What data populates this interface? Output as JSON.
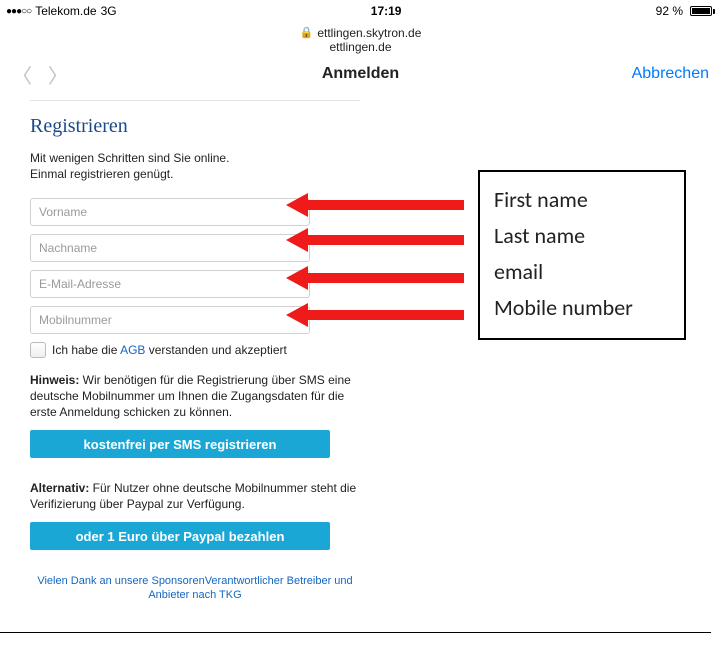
{
  "status": {
    "carrier": "Telekom.de",
    "network": "3G",
    "time": "17:19",
    "battery_pct": "92 %"
  },
  "browser": {
    "domain_full": "ettlingen.skytron.de",
    "domain_short": "ettlingen.de"
  },
  "toolbar": {
    "title": "Anmelden",
    "cancel": "Abbrechen"
  },
  "reg": {
    "heading": "Registrieren",
    "intro1": "Mit wenigen Schritten sind Sie online.",
    "intro2": "Einmal registrieren genügt.",
    "fields": {
      "first": "Vorname",
      "last": "Nachname",
      "email": "E-Mail-Adresse",
      "mobile": "Mobilnummer"
    },
    "consent_pre": "Ich habe die ",
    "consent_link": "AGB",
    "consent_post": " verstanden und akzeptiert",
    "note_label": "Hinweis:",
    "note_text": " Wir benötigen für die Registrierung über SMS eine deutsche Mobilnummer um Ihnen die Zugangsdaten für die erste Anmeldung schicken zu können.",
    "btn_sms": "kostenfrei per SMS registrieren",
    "alt_label": "Alternativ:",
    "alt_text": " Für Nutzer ohne deutsche Mobilnummer steht die Verifizierung über Paypal zur Verfügung.",
    "btn_paypal": "oder 1 Euro über Paypal bezahlen",
    "sponsor1": "Vielen Dank an unsere Sponsoren",
    "sponsor2": "Verantwortlicher Betreiber und Anbieter nach TKG"
  },
  "legend": {
    "first": "First name",
    "last": "Last name",
    "email": "email",
    "mobile": "Mobile number"
  }
}
